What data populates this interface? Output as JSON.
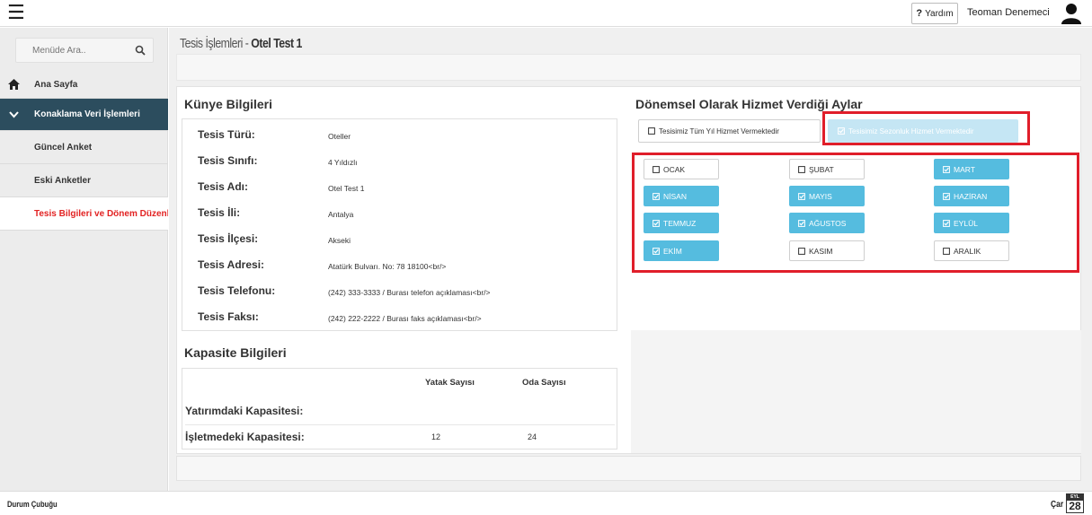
{
  "topbar": {
    "help_label": "Yardım",
    "help_mark": "?",
    "user_name": "Teoman Denemeci"
  },
  "sidebar": {
    "search_placeholder": "Menüde Ara..",
    "items": [
      {
        "label": "Ana Sayfa",
        "icon": "home-icon"
      },
      {
        "label": "Konaklama Veri İşlemleri",
        "icon": "chevron-down-icon"
      },
      {
        "label": "Güncel Anket"
      },
      {
        "label": "Eski Anketler"
      },
      {
        "label": "Tesis Bilgileri ve Dönem Düzenle"
      }
    ]
  },
  "page": {
    "title_prefix": "Tesis İşlemleri - ",
    "title_name": "Otel Test 1"
  },
  "kunye": {
    "heading": "Künye Bilgileri",
    "rows": [
      {
        "label": "Tesis Türü:",
        "value": "Oteller"
      },
      {
        "label": "Tesis Sınıfı:",
        "value": "4 Yıldızlı"
      },
      {
        "label": "Tesis Adı:",
        "value": "Otel Test 1"
      },
      {
        "label": "Tesis İli:",
        "value": "Antalya"
      },
      {
        "label": "Tesis İlçesi:",
        "value": "Akseki"
      },
      {
        "label": "Tesis Adresi:",
        "value": "Atatürk Bulvarı. No: 78 18100<br/>"
      },
      {
        "label": "Tesis Telefonu:",
        "value": "(242) 333-3333 / Burası telefon açıklaması<br/>"
      },
      {
        "label": "Tesis Faksı:",
        "value": "(242) 222-2222 / Burası faks açıklaması<br/>"
      }
    ]
  },
  "kapasite": {
    "heading": "Kapasite Bilgileri",
    "col_bed": "Yatak Sayısı",
    "col_room": "Oda Sayısı",
    "row_investment": "Yatırımdaki Kapasitesi:",
    "row_operating": "İşletmedeki Kapasitesi:",
    "operating_bed": "12",
    "operating_room": "24"
  },
  "months_section": {
    "heading": "Dönemsel Olarak Hizmet Verdiği Aylar",
    "option_all_year": "Tesisimiz Tüm Yıl Hizmet Vermektedir",
    "option_seasonal": "Tesisimiz Sezonluk Hizmet Vermektedir",
    "months": [
      {
        "label": "OCAK",
        "checked": false
      },
      {
        "label": "ŞUBAT",
        "checked": false
      },
      {
        "label": "MART",
        "checked": true
      },
      {
        "label": "NİSAN",
        "checked": true
      },
      {
        "label": "MAYIS",
        "checked": true
      },
      {
        "label": "HAZİRAN",
        "checked": true
      },
      {
        "label": "TEMMUZ",
        "checked": true
      },
      {
        "label": "AĞUSTOS",
        "checked": true
      },
      {
        "label": "EYLÜL",
        "checked": true
      },
      {
        "label": "EKİM",
        "checked": true
      },
      {
        "label": "KASIM",
        "checked": false
      },
      {
        "label": "ARALIK",
        "checked": false
      }
    ]
  },
  "statusbar": {
    "label": "Durum Çubuğu",
    "day_name": "Çar",
    "cal_month": "EYL",
    "cal_day": "28"
  },
  "colors": {
    "sidebar_active": "#2c4d5e",
    "month_on": "#55bcdf",
    "highlight_red": "#e01e2a",
    "menu_highlight_text": "#e22222"
  }
}
